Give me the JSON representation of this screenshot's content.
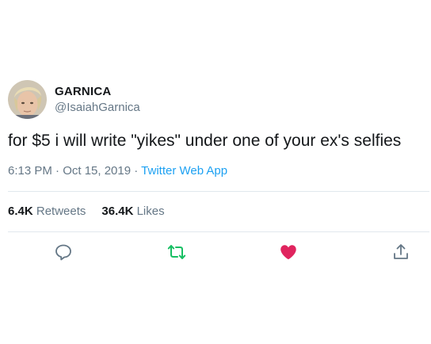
{
  "user": {
    "display_name": "GARNICA",
    "handle": "@IsaiahGarnica"
  },
  "tweet": {
    "text": "for $5 i will write \"yikes\" under one of your ex's selfies",
    "time": "6:13 PM · Oct 15, 2019 · ",
    "source": "Twitter Web App"
  },
  "stats": {
    "retweets_count": "6.4K",
    "retweets_label": "Retweets",
    "likes_count": "36.4K",
    "likes_label": "Likes"
  },
  "actions": {
    "icons": [
      "reply-icon",
      "retweet-icon",
      "like-icon",
      "share-icon"
    ],
    "retweet_color": "#17bf63",
    "like_color": "#e0245e",
    "neutral_color": "#657786"
  },
  "colors": {
    "link": "#1da1f2",
    "text": "#14171a",
    "secondary": "#657786",
    "divider": "#e1e8ed"
  }
}
